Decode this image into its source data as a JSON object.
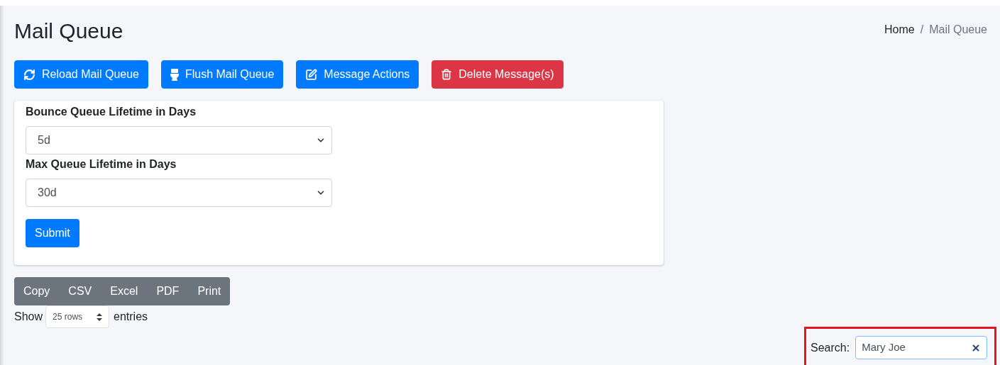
{
  "page_title": "Mail Queue",
  "breadcrumb": [
    {
      "label": "Home",
      "kind": "link"
    },
    {
      "label": "/",
      "kind": "separator"
    },
    {
      "label": "Mail Queue",
      "kind": "current"
    }
  ],
  "actions": [
    {
      "label": "Reload Mail Queue",
      "kind": "reload"
    },
    {
      "label": "Flush Mail Queue",
      "kind": "flush"
    },
    {
      "label": "Message Actions",
      "kind": "actions"
    },
    {
      "label": "Delete Message(s)",
      "kind": "delete"
    }
  ],
  "settings_form": {
    "fields": [
      {
        "label": "Bounce Queue Lifetime in Days",
        "value": "5d"
      },
      {
        "label": "Max Queue Lifetime in Days",
        "value": "30d"
      }
    ],
    "submit": "Submit"
  },
  "export_buttons": [
    "Copy",
    "CSV",
    "Excel",
    "PDF",
    "Print"
  ],
  "length_control": {
    "prefix": "Show",
    "value": "25 rows",
    "suffix": "entries"
  },
  "search": {
    "label": "Search:",
    "value": "Mary Joe",
    "highlighted": true
  }
}
